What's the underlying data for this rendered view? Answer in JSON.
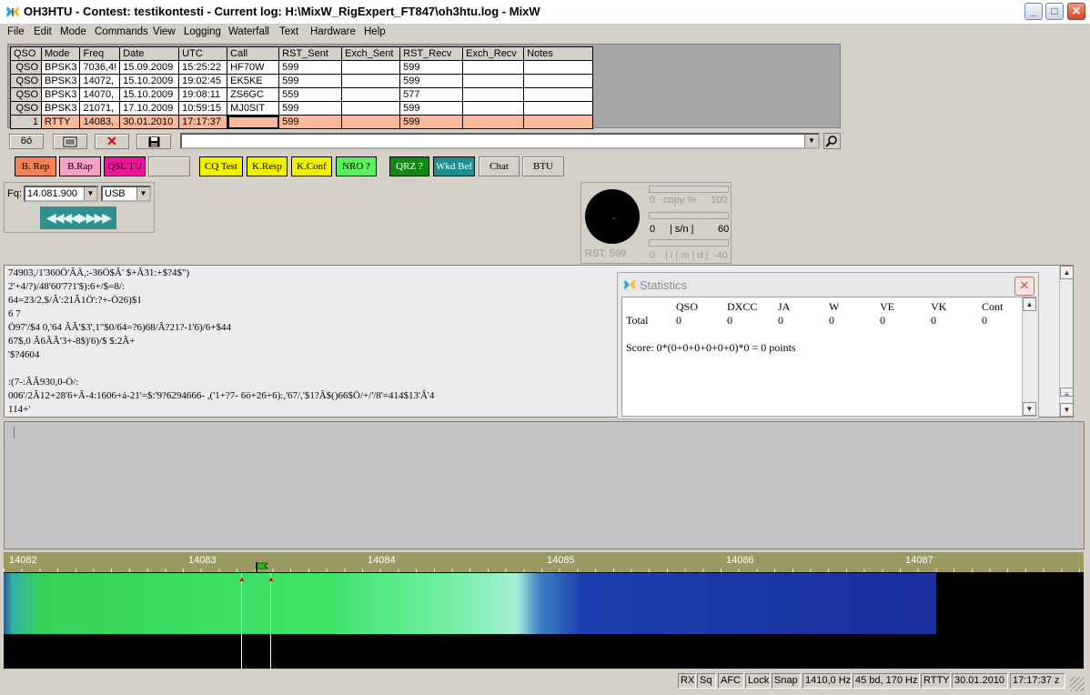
{
  "window": {
    "title": "OH3HTU - Contest: testikontesti - Current log: H:\\MixW_RigExpert_FT847\\oh3htu.log - MixW",
    "minimize": "_",
    "maximize": "□",
    "close": "✕"
  },
  "menu": [
    "File",
    "Edit",
    "Mode",
    "Commands",
    "View",
    "Logging",
    "Waterfall",
    "Text",
    "Hardware",
    "Help"
  ],
  "log": {
    "columns": [
      "QSO",
      "Mode",
      "Freq",
      "Date",
      "UTC",
      "Call",
      "RST_Sent",
      "Exch_Sent",
      "RST_Recv",
      "Exch_Recv",
      "Notes"
    ],
    "rows": [
      {
        "qso": "QSO",
        "mode": "BPSK3",
        "freq": "7036,4!",
        "date": "15.09.2009",
        "utc": "15:25:22",
        "call": "HF70W",
        "rst_sent": "599",
        "exch_sent": "",
        "rst_recv": "599",
        "exch_recv": "",
        "notes": ""
      },
      {
        "qso": "QSO",
        "mode": "BPSK3",
        "freq": "14072,",
        "date": "15.10.2009",
        "utc": "19:02:45",
        "call": "EK5KE",
        "rst_sent": "599",
        "exch_sent": "",
        "rst_recv": "599",
        "exch_recv": "",
        "notes": ""
      },
      {
        "qso": "QSO",
        "mode": "BPSK3",
        "freq": "14070,",
        "date": "15.10.2009",
        "utc": "19:08:11",
        "call": "ZS6GC",
        "rst_sent": "559",
        "exch_sent": "",
        "rst_recv": "577",
        "exch_recv": "",
        "notes": ""
      },
      {
        "qso": "QSO",
        "mode": "BPSK3",
        "freq": "21071,",
        "date": "17.10.2009",
        "utc": "10:59:15",
        "call": "MJ0SIT",
        "rst_sent": "599",
        "exch_sent": "",
        "rst_recv": "599",
        "exch_recv": "",
        "notes": ""
      },
      {
        "qso": "1",
        "mode": "RTTY",
        "freq": "14083,",
        "date": "30.01.2010",
        "utc": "17:17:37",
        "call": "",
        "rst_sent": "599",
        "exch_sent": "",
        "rst_recv": "599",
        "exch_recv": "",
        "notes": ""
      }
    ]
  },
  "toolbar": {
    "binoculars": "6ó",
    "delete": "✕"
  },
  "macros": [
    {
      "label": "B. Rep",
      "bg": "#f4815a"
    },
    {
      "label": "B.Rap",
      "bg": "#f7a0c8"
    },
    {
      "label": "QSL TU",
      "bg": "#f0149a"
    },
    {
      "label": "",
      "bg": "#d4d0c8"
    },
    {
      "label": "CQ Test",
      "bg": "#f2f200"
    },
    {
      "label": "K.Resp",
      "bg": "#f2f200"
    },
    {
      "label": "K.Conf",
      "bg": "#f2f200"
    },
    {
      "label": "NRO ?",
      "bg": "#5cee5c"
    },
    {
      "label": "QRZ ?",
      "bg": "#118811"
    },
    {
      "label": "Wkd Bef",
      "bg": "#1d8e8e"
    },
    {
      "label": "Chat",
      "bg": "#d4d0c8"
    },
    {
      "label": "BTU",
      "bg": "#d4d0c8"
    }
  ],
  "freq": {
    "label": "Fq:",
    "value": "14.081.900",
    "mode": "USB",
    "tune_glyphs": "◀◀◀◀▶▶▶▶"
  },
  "meters": {
    "copy_min": "0",
    "copy_label": "copy %",
    "copy_max": "100",
    "sn_min": "0",
    "sn_label": "| s/n |",
    "sn_max": "60",
    "imd_min": "0",
    "imd_label": "| i | m | d |",
    "imd_max": "-40",
    "rst": "RST: 599"
  },
  "rx_lines": [
    "74903,/1'360Ö'ÂÄ,:-36Ö$Â' $+Â31:+$?4$\")",
    "2'+4/?)/48'60'7?1'$):6+/$=8/:",
    "64=23/2,$/Â':21Â1Ö':?+-Ö26)$1",
    "6 7",
    "Ö97'/$4 0,'64 ÂÂ'$3',1\"$0/64=?6)68/Â?21?-1'6)/6+$44",
    "67$,0 Â6ÂÂ'3+-8$)'6)/$ $:2Â+",
    "'$?4604",
    "",
    ":(7-:ÂÂ930,0-Ö/:",
    "006'/2Â12+28'6+Â-4:1606+á-21'=$:'9?6294666- ,('1+?7- 6ö+26+6):,'67/,'$1?Â$()66$Ö/+/'/8'=414$13'Â'4",
    "114+'"
  ],
  "stats": {
    "title": "Statistics",
    "columns": [
      "QSO",
      "DXCC",
      "JA",
      "W",
      "VE",
      "VK",
      "Cont"
    ],
    "row_label": "Total",
    "row_values": [
      "0",
      "0",
      "0",
      "0",
      "0",
      "0",
      "0"
    ],
    "score": "Score: 0*(0+0+0+0+0+0)*0 = 0 points"
  },
  "waterfall": {
    "ticks": [
      "14082",
      "14083",
      "14084",
      "14085",
      "14086",
      "14087"
    ]
  },
  "status": [
    "RX",
    "Sq",
    "AFC",
    "Lock",
    "Snap",
    "1410,0 Hz",
    "45 bd, 170 Hz",
    "RTTY",
    "30.01.2010",
    "17:17:37 z"
  ],
  "colors": {
    "current_row": "#fbb89a",
    "waterfall_green": "#3ee46a",
    "waterfall_blue": "#1b2f9a"
  }
}
